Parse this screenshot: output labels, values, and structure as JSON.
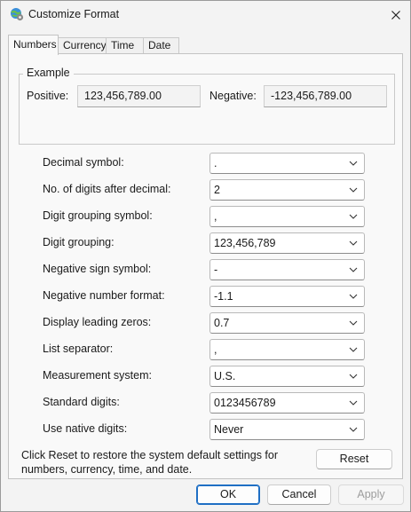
{
  "window": {
    "title": "Customize Format",
    "icon": "globe-settings-icon"
  },
  "tabs": [
    {
      "label": "Numbers",
      "active": true
    },
    {
      "label": "Currency",
      "active": false
    },
    {
      "label": "Time",
      "active": false
    },
    {
      "label": "Date",
      "active": false
    }
  ],
  "example": {
    "title": "Example",
    "positive_label": "Positive:",
    "positive_value": "123,456,789.00",
    "negative_label": "Negative:",
    "negative_value": "-123,456,789.00"
  },
  "settings": [
    {
      "label": "Decimal symbol:",
      "value": "."
    },
    {
      "label": "No. of digits after decimal:",
      "value": "2"
    },
    {
      "label": "Digit grouping symbol:",
      "value": ","
    },
    {
      "label": "Digit grouping:",
      "value": "123,456,789"
    },
    {
      "label": "Negative sign symbol:",
      "value": "-"
    },
    {
      "label": "Negative number format:",
      "value": "-1.1"
    },
    {
      "label": "Display leading zeros:",
      "value": "0.7"
    },
    {
      "label": "List separator:",
      "value": ","
    },
    {
      "label": "Measurement system:",
      "value": "U.S."
    },
    {
      "label": "Standard digits:",
      "value": "0123456789"
    },
    {
      "label": "Use native digits:",
      "value": "Never"
    }
  ],
  "reset_note": "Click Reset to restore the system default settings for numbers, currency, time, and date.",
  "buttons": {
    "reset": "Reset",
    "ok": "OK",
    "cancel": "Cancel",
    "apply": "Apply"
  },
  "colors": {
    "accent": "#1f6fc4",
    "window_bg": "#f3f3f3",
    "panel_bg": "#f9f9f9"
  }
}
